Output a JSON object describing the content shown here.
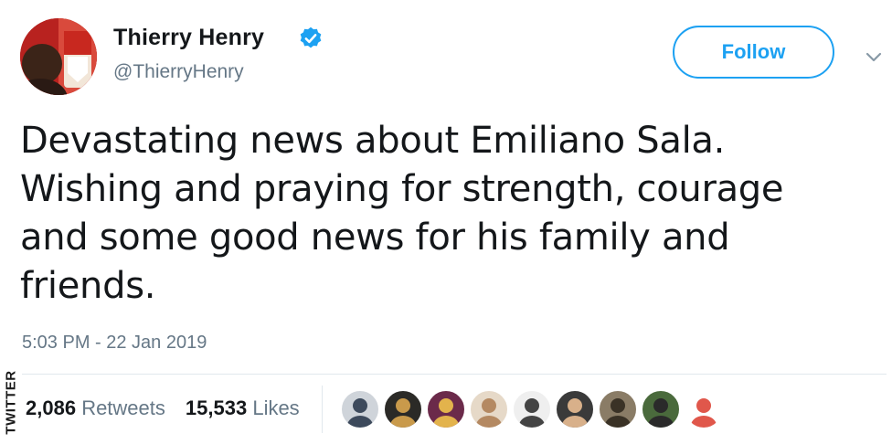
{
  "tweet": {
    "display_name": "Thierry Henry",
    "handle": "@ThierryHenry",
    "verified": true,
    "follow_label": "Follow",
    "text": "Devastating news about Emiliano Sala.\nWishing and praying for strength, courage\nand some good news for his family and\nfriends.",
    "timestamp": "5:03 PM - 22 Jan 2019"
  },
  "stats": {
    "retweets_count": "2,086",
    "retweets_label": "Retweets",
    "likes_count": "15,533",
    "likes_label": "Likes"
  },
  "watermark": "TWITTER",
  "icons": {
    "verified": "verified-badge-icon",
    "caret": "chevron-down-icon"
  },
  "colors": {
    "accent": "#1da1f2",
    "secondary_text": "#657786",
    "primary_text": "#14171a",
    "divider": "#e1e8ed"
  },
  "likers": [
    {
      "name": "liker-avatar-1",
      "bg": "#cfd4da",
      "fg": "#3d4a5c"
    },
    {
      "name": "liker-avatar-2",
      "bg": "#2b2a27",
      "fg": "#c99a4b"
    },
    {
      "name": "liker-avatar-3",
      "bg": "#6b2a4a",
      "fg": "#e3b34c"
    },
    {
      "name": "liker-avatar-4",
      "bg": "#e6d9c8",
      "fg": "#b48962"
    },
    {
      "name": "liker-avatar-5",
      "bg": "#efefef",
      "fg": "#444444"
    },
    {
      "name": "liker-avatar-6",
      "bg": "#3a3a3a",
      "fg": "#d8b08a"
    },
    {
      "name": "liker-avatar-7",
      "bg": "#8a7c66",
      "fg": "#3a3226"
    },
    {
      "name": "liker-avatar-8",
      "bg": "#4a6a3c",
      "fg": "#2a2a2a"
    },
    {
      "name": "liker-avatar-9",
      "bg": "#ffffff",
      "fg": "#e0574b"
    }
  ]
}
